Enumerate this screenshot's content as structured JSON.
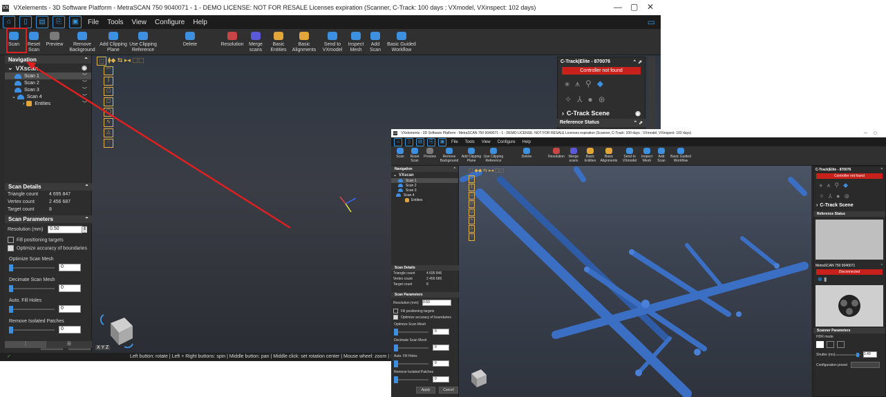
{
  "main_window": {
    "title": "VXelements - 3D Software Platform - MetraSCAN 750 9040071 - 1 - DEMO LICENSE: NOT FOR RESALE Licenses expiration (Scanner, C-Track: 100 days ; VXmodel, VXinspect: 102 days)",
    "menus": [
      "File",
      "Tools",
      "View",
      "Configure",
      "Help"
    ],
    "ribbon": [
      {
        "label": "Scan",
        "color": "#3d8fe0"
      },
      {
        "label": "Reset Scan",
        "color": "#3d8fe0"
      },
      {
        "label": "Preview",
        "color": "#7a7a7a"
      },
      {
        "label": "Remove Background",
        "color": "#3d8fe0"
      },
      {
        "label": "Add Clipping Plane",
        "color": "#3d8fe0"
      },
      {
        "label": "Use Clipping Reference",
        "color": "#3d8fe0"
      },
      {
        "label": "Delete",
        "color": "#3d8fe0"
      },
      {
        "label": "Resolution",
        "color": "#c84545"
      },
      {
        "label": "Merge scans",
        "color": "#5a5ad8"
      },
      {
        "label": "Basic Entities",
        "color": "#e2a53a"
      },
      {
        "label": "Basic Alignments",
        "color": "#e2a53a"
      },
      {
        "label": "Send to VXmodel",
        "color": "#3d8fe0"
      },
      {
        "label": "Inspect Mesh",
        "color": "#3d8fe0"
      },
      {
        "label": "Add Scan",
        "color": "#3d8fe0"
      },
      {
        "label": "Basic Guided Workflow",
        "color": "#3d8fe0"
      }
    ],
    "navigation": {
      "header": "Navigation",
      "root": "VXscan",
      "items": [
        "Scan 1",
        "Scan 2",
        "Scan 3",
        "Scan 4"
      ],
      "child": "Entities"
    },
    "scan_details": {
      "header": "Scan Details",
      "rows": [
        {
          "label": "Triangle count",
          "value": "4 695 847"
        },
        {
          "label": "Vertex count",
          "value": "2 456 687"
        },
        {
          "label": "Target count",
          "value": "8"
        }
      ]
    },
    "scan_parameters": {
      "header": "Scan Parameters",
      "resolution_label": "Resolution (mm)",
      "resolution_value": "0.50",
      "fill_targets": "Fill positioning targets",
      "optimize_boundaries": "Optimize accuracy of boundaries",
      "sliders": [
        {
          "label": "Optimize Scan Mesh",
          "value": "0"
        },
        {
          "label": "Decimate Scan Mesh",
          "value": "0"
        },
        {
          "label": "Auto. Fill Holes",
          "value": "0"
        },
        {
          "label": "Remove Isolated Patches",
          "value": "0"
        }
      ],
      "apply": "Apply",
      "cancel": "Cancel"
    },
    "ctrack": {
      "title": "C-Track|Elite - 870076",
      "status": "Controller not found",
      "scene": "C-Track Scene",
      "reference_status": "Reference Status"
    },
    "axis_label": "X Y Z",
    "status_text": "Left button: rotate | Left + Right buttons: spin | Middle button: pan | Middle click: set rotation center | Mouse wheel: zoom | Shift + Middle bu"
  },
  "inset_window": {
    "title": "VXelements - 3D Software Platform - MetraSCAN 750 9040071 - 1 - DEMO LICENSE: NOT FOR RESALE Licenses expiration (Scanner, C-Track: 100 days ; VXmodel, VXinspect: 102 days)",
    "menus": [
      "File",
      "Tools",
      "View",
      "Configure",
      "Help"
    ],
    "ribbon": [
      "Scan",
      "Reset Scan",
      "Preview",
      "Remove Background",
      "Add Clipping Plane",
      "Use Clipping Reference",
      "Delete",
      "Resolution",
      "Merge scans",
      "Basic Entities",
      "Basic Alignments",
      "Send to VXmodel",
      "Inspect Mesh",
      "Add Scan",
      "Basic Guided Workflow"
    ],
    "navigation": {
      "header": "Navigation",
      "root": "VXscan",
      "items": [
        "Scan 1",
        "Scan 2",
        "Scan 3",
        "Scan 4"
      ],
      "child": "Entities"
    },
    "scan_details": {
      "header": "Scan Details",
      "rows": [
        {
          "label": "Triangle count",
          "value": "4 695 846"
        },
        {
          "label": "Vertex count",
          "value": "2 456 686"
        },
        {
          "label": "Target count",
          "value": "8"
        }
      ]
    },
    "scan_parameters": {
      "header": "Scan Parameters",
      "resolution_label": "Resolution (mm)",
      "resolution_value": "0.50",
      "fill_targets": "Fill positioning targets",
      "optimize_boundaries": "Optimize accuracy of boundaries",
      "sliders": [
        {
          "label": "Optimize Scan Mesh",
          "value": "0"
        },
        {
          "label": "Decimate Scan Mesh",
          "value": "0"
        },
        {
          "label": "Auto. Fill Holes",
          "value": "0"
        },
        {
          "label": "Remove Isolated Patches",
          "value": "0"
        }
      ],
      "apply": "Apply",
      "cancel": "Cancel"
    },
    "ctrack": {
      "title": "C-Track|Elite - 870076",
      "status": "Controller not found",
      "scene": "C-Track Scene",
      "reference_status": "Reference Status"
    },
    "scanner": {
      "title": "MetraSCAN 750 9040071",
      "status": "Disconnected"
    },
    "scanner_parameters": {
      "header": "Scanner Parameters",
      "hdr_mode": "HDR mode",
      "shutter_label": "Shutter (ms)",
      "shutter_value": "1.49",
      "config_preset": "Configuration preset"
    }
  },
  "colors": {
    "highlight": "#e02020",
    "accent": "#3d8fe0",
    "error": "#c8211b",
    "mesh": "#3b6fc4"
  }
}
